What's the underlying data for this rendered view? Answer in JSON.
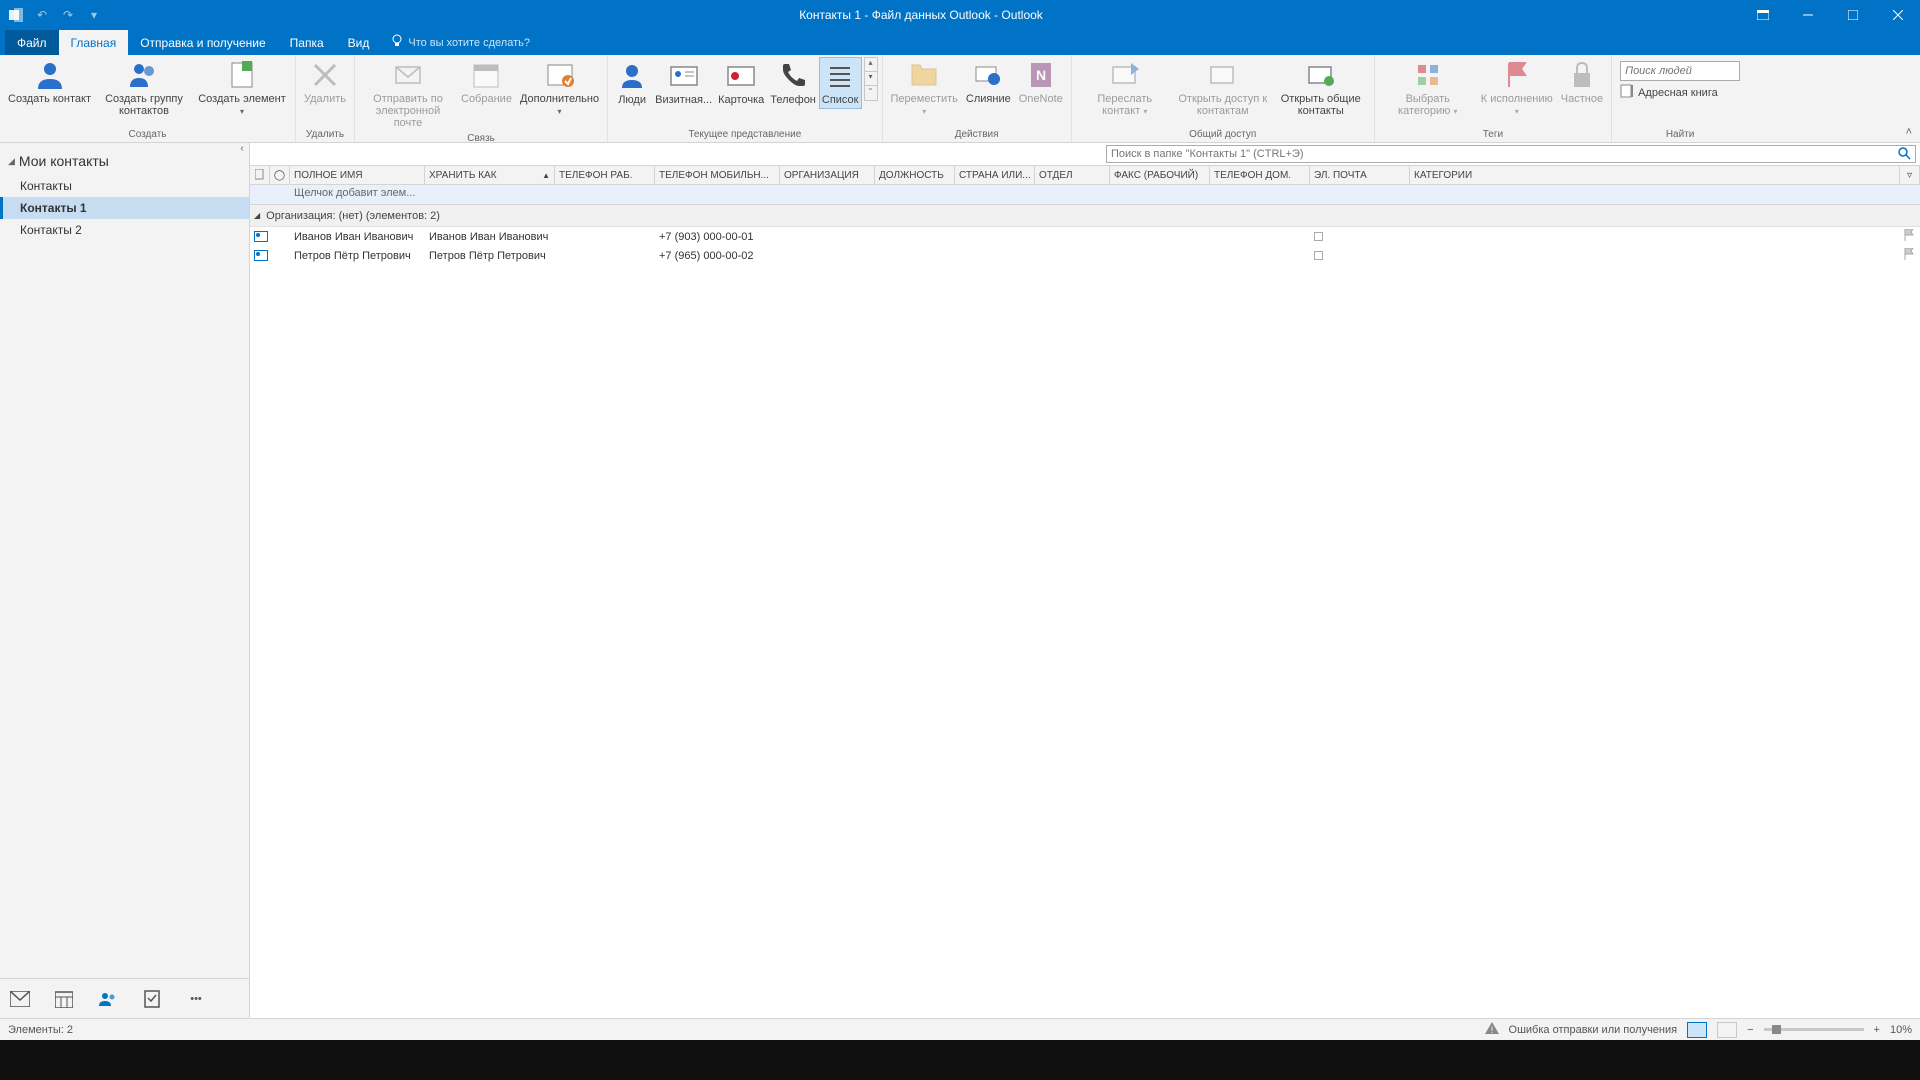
{
  "window": {
    "title": "Контакты 1 - Файл данных Outlook - Outlook"
  },
  "tabs": {
    "file": "Файл",
    "home": "Главная",
    "sendrecv": "Отправка и получение",
    "folder": "Папка",
    "view": "Вид",
    "tellme": "Что вы хотите сделать?"
  },
  "ribbon": {
    "groups": {
      "new": "Создать",
      "delete": "Удалить",
      "communicate": "Связь",
      "currentview": "Текущее представление",
      "actions": "Действия",
      "share": "Общий доступ",
      "tags": "Теги",
      "find": "Найти"
    },
    "buttons": {
      "new_contact": "Создать контакт",
      "new_group": "Создать группу контактов",
      "new_item": "Создать элемент",
      "delete": "Удалить",
      "email": "Отправить по электронной почте",
      "meeting": "Собрание",
      "more": "Дополнительно",
      "view_people": "Люди",
      "view_card": "Визитная...",
      "view_card2": "Карточка",
      "view_phone": "Телефон",
      "view_list": "Список",
      "move": "Переместить",
      "mailmerge": "Слияние",
      "onenote": "OneNote",
      "forward": "Переслать контакт",
      "share_contacts": "Открыть доступ к контактам",
      "open_shared": "Открыть общие контакты",
      "categorize": "Выбрать категорию",
      "followup": "К исполнению",
      "private": "Частное"
    },
    "find": {
      "search_people": "Поиск людей",
      "address_book": "Адресная книга"
    }
  },
  "sidebar": {
    "header": "Мои контакты",
    "items": [
      {
        "label": "Контакты",
        "active": false
      },
      {
        "label": "Контакты 1",
        "active": true
      },
      {
        "label": "Контакты 2",
        "active": false
      }
    ]
  },
  "search": {
    "placeholder": "Поиск в папке \"Контакты 1\" (CTRL+Э)"
  },
  "columns": {
    "fullname": "ПОЛНОЕ ИМЯ",
    "fileas": "ХРАНИТЬ КАК",
    "work_phone": "ТЕЛЕФОН РАБ.",
    "mobile": "ТЕЛЕФОН МОБИЛЬН...",
    "company": "ОРГАНИЗАЦИЯ",
    "title": "ДОЛЖНОСТЬ",
    "country": "СТРАНА ИЛИ...",
    "department": "ОТДЕЛ",
    "fax": "ФАКС (РАБОЧИЙ)",
    "home_phone": "ТЕЛЕФОН ДОМ.",
    "email": "ЭЛ. ПОЧТА",
    "categories": "КАТЕГОРИИ"
  },
  "new_row_hint": "Щелчок добавит элем...",
  "group_header": "Организация: (нет) (элементов: 2)",
  "rows": [
    {
      "fullname": "Иванов Иван Иванович",
      "fileas": "Иванов Иван Иванович",
      "mobile": "+7 (903) 000-00-01"
    },
    {
      "fullname": "Петров Пётр Петрович",
      "fileas": "Петров Пётр Петрович",
      "mobile": "+7 (965) 000-00-02"
    }
  ],
  "status": {
    "items": "Элементы: 2",
    "error": "Ошибка отправки или получения",
    "zoom": "10%"
  },
  "col_widths": {
    "icon1": 20,
    "icon2": 20,
    "fullname": 135,
    "fileas": 130,
    "work_phone": 100,
    "mobile": 125,
    "company": 95,
    "title": 80,
    "country": 80,
    "department": 75,
    "fax": 100,
    "home_phone": 100,
    "email": 100,
    "categories": 155,
    "flag": 20
  }
}
